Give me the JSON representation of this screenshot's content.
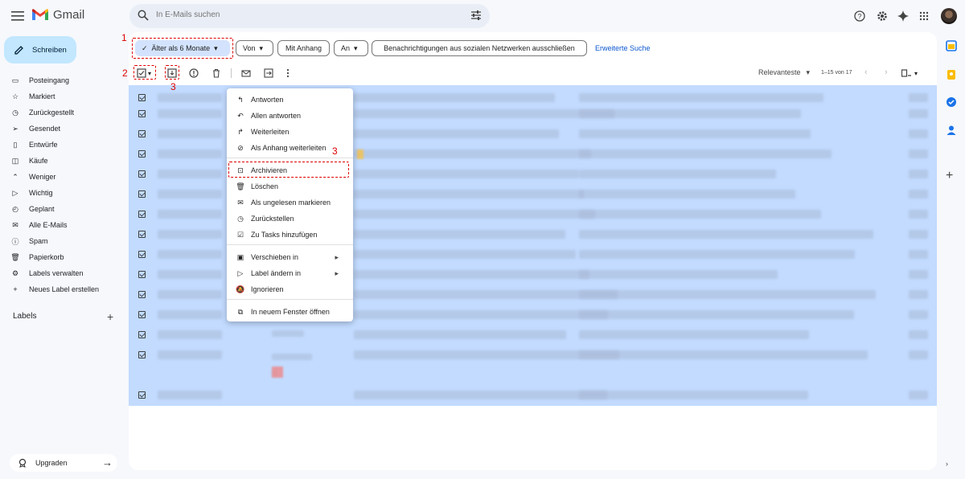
{
  "app": {
    "name": "Gmail"
  },
  "search": {
    "placeholder": "In E-Mails suchen"
  },
  "compose": {
    "label": "Schreiben"
  },
  "sidebar": {
    "items": [
      {
        "label": "Posteingang",
        "icon": "inbox-icon"
      },
      {
        "label": "Markiert",
        "icon": "star-icon"
      },
      {
        "label": "Zurückgestellt",
        "icon": "clock-icon"
      },
      {
        "label": "Gesendet",
        "icon": "send-icon"
      },
      {
        "label": "Entwürfe",
        "icon": "draft-icon"
      },
      {
        "label": "Käufe",
        "icon": "purchases-icon"
      },
      {
        "label": "Weniger",
        "icon": "chevron-up-icon"
      },
      {
        "label": "Wichtig",
        "icon": "important-icon"
      },
      {
        "label": "Geplant",
        "icon": "scheduled-icon"
      },
      {
        "label": "Alle E-Mails",
        "icon": "all-mail-icon"
      },
      {
        "label": "Spam",
        "icon": "spam-icon"
      },
      {
        "label": "Papierkorb",
        "icon": "trash-icon"
      },
      {
        "label": "Labels verwalten",
        "icon": "gear-icon"
      },
      {
        "label": "Neues Label erstellen",
        "icon": "plus-icon"
      }
    ],
    "labels_title": "Labels",
    "upgrade": "Upgraden"
  },
  "filters": {
    "age": "Älter als 6 Monate",
    "from": "Von",
    "attachment": "Mit Anhang",
    "to": "An",
    "exclude_social": "Benachrichtigungen aus sozialen Netzwerken ausschließen",
    "advanced": "Erweiterte Suche"
  },
  "toolbar": {
    "sort": "Relevanteste",
    "count": "1–15 von 17"
  },
  "annotations": [
    "1",
    "2",
    "3",
    "3"
  ],
  "context_menu": {
    "items": [
      {
        "label": "Antworten",
        "icon": "reply-icon"
      },
      {
        "label": "Allen antworten",
        "icon": "reply-all-icon"
      },
      {
        "label": "Weiterleiten",
        "icon": "forward-icon"
      },
      {
        "label": "Als Anhang weiterleiten",
        "icon": "attachment-icon"
      },
      {
        "label": "Archivieren",
        "icon": "archive-icon"
      },
      {
        "label": "Löschen",
        "icon": "trash-icon"
      },
      {
        "label": "Als ungelesen markieren",
        "icon": "mark-unread-icon"
      },
      {
        "label": "Zurückstellen",
        "icon": "clock-icon"
      },
      {
        "label": "Zu Tasks hinzufügen",
        "icon": "add-task-icon"
      },
      {
        "label": "Verschieben in",
        "icon": "move-to-icon"
      },
      {
        "label": "Label ändern in",
        "icon": "label-icon"
      },
      {
        "label": "Ignorieren",
        "icon": "mute-icon"
      },
      {
        "label": "In neuem Fenster öffnen",
        "icon": "open-new-window-icon"
      }
    ]
  },
  "colors": {
    "accent": "#0b57d0",
    "selected_row": "#c2dbff",
    "compose_bg": "#c2e7ff",
    "annotation": "#dd0000"
  }
}
